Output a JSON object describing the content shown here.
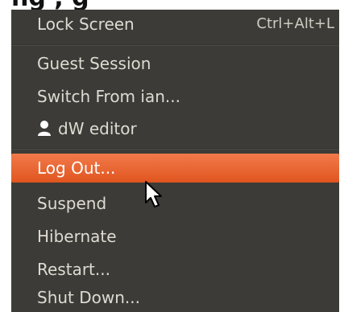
{
  "menu": {
    "top_partial_text": "ng  ,  g",
    "items": [
      {
        "label": "Lock Screen",
        "accelerator": "Ctrl+Alt+L"
      },
      {
        "label": "Guest Session"
      },
      {
        "label": "Switch From ian..."
      },
      {
        "label": "dW editor",
        "icon": "user-icon"
      },
      {
        "label": "Log Out...",
        "highlighted": true
      },
      {
        "label": "Suspend"
      },
      {
        "label": "Hibernate"
      },
      {
        "label": "Restart..."
      },
      {
        "label": "Shut Down..."
      }
    ]
  },
  "colors": {
    "menu_background": "#3c3b37",
    "menu_text": "#dfdbd2",
    "highlight": "#e9602b",
    "highlight_text": "#ffffff"
  }
}
